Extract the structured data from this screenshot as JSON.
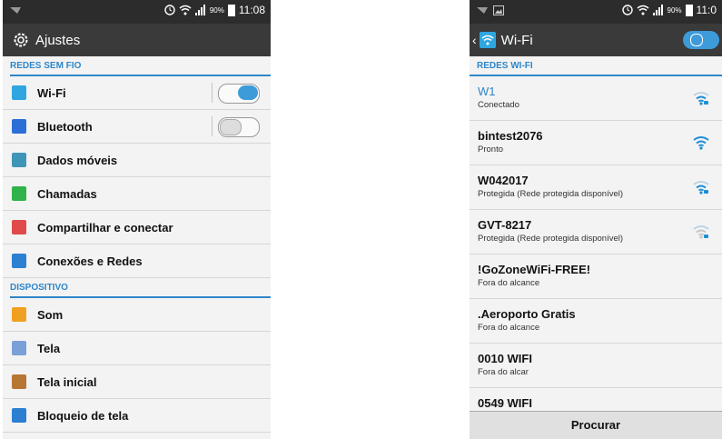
{
  "left": {
    "status": {
      "battery": "90%",
      "time": "11:08"
    },
    "title": "Ajustes",
    "sections": [
      {
        "header": "REDES SEM FIO",
        "items": [
          {
            "label": "Wi-Fi",
            "icon": "wifi-icon",
            "color": "#2fa6e0",
            "toggle": "on"
          },
          {
            "label": "Bluetooth",
            "icon": "bluetooth-icon",
            "color": "#2b6fd6",
            "toggle": "off"
          },
          {
            "label": "Dados móveis",
            "icon": "mobile-data-icon",
            "color": "#3f95b8"
          },
          {
            "label": "Chamadas",
            "icon": "phone-icon",
            "color": "#30b34a"
          },
          {
            "label": "Compartilhar e conectar",
            "icon": "share-connect-icon",
            "color": "#e04a4a"
          },
          {
            "label": "Conexões e Redes",
            "icon": "networks-icon",
            "color": "#2c7fd1"
          }
        ]
      },
      {
        "header": "DISPOSITIVO",
        "items": [
          {
            "label": "Som",
            "icon": "sound-icon",
            "color": "#f0a020"
          },
          {
            "label": "Tela",
            "icon": "display-icon",
            "color": "#7aa0d8"
          },
          {
            "label": "Tela inicial",
            "icon": "home-icon",
            "color": "#b77632"
          },
          {
            "label": "Bloqueio de tela",
            "icon": "lock-screen-icon",
            "color": "#2c7fd1"
          }
        ]
      }
    ]
  },
  "right": {
    "status": {
      "battery": "90%",
      "time": "11:0"
    },
    "title": "Wi-Fi",
    "section": "REDES WI-FI",
    "networks": [
      {
        "ssid": "W1",
        "state": "Conectado",
        "active": true,
        "signal": "strong-lock"
      },
      {
        "ssid": "bintest2076",
        "state": "Pronto",
        "active": false,
        "signal": "strong"
      },
      {
        "ssid": "W042017",
        "state": "Protegida (Rede protegida disponível)",
        "active": false,
        "signal": "lock"
      },
      {
        "ssid": "GVT-8217",
        "state": "Protegida (Rede protegida disponível)",
        "active": false,
        "signal": "lock-weak"
      },
      {
        "ssid": "!GoZoneWiFi-FREE!",
        "state": "Fora do alcance",
        "active": false,
        "signal": "none"
      },
      {
        "ssid": ".Aeroporto Gratis",
        "state": "Fora do alcance",
        "active": false,
        "signal": "none"
      },
      {
        "ssid": "0010 WIFI",
        "state": "Fora do alcar",
        "active": false,
        "signal": "none"
      },
      {
        "ssid": "0549 WIFI",
        "state": "",
        "active": false,
        "signal": "none"
      }
    ],
    "button": "Procurar"
  }
}
